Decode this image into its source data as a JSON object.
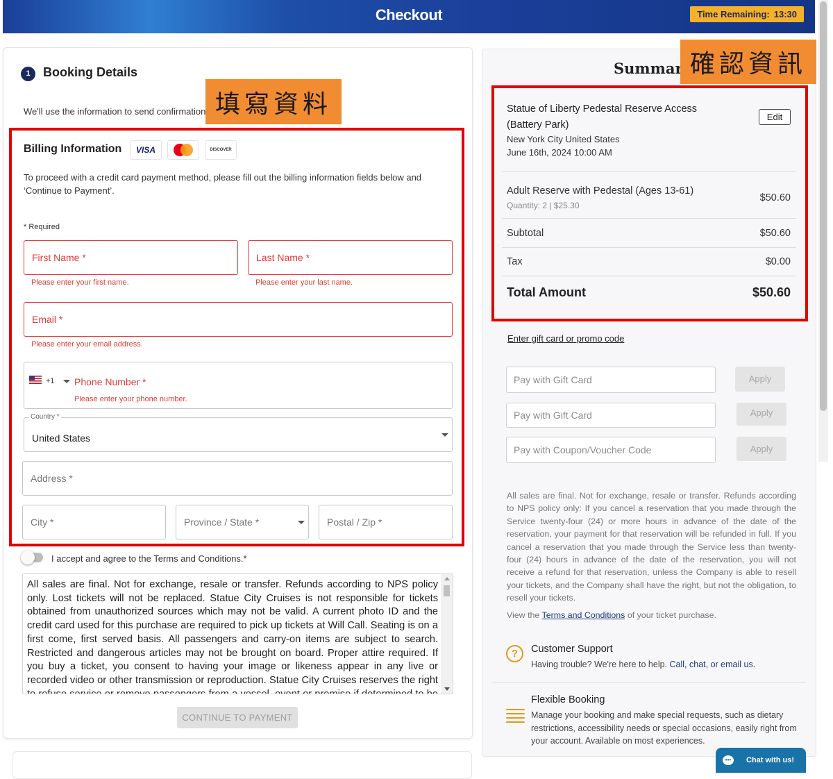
{
  "header": {
    "title": "Checkout",
    "timer_label": "Time Remaining:",
    "timer_value": "13:30"
  },
  "booking": {
    "step_number": "1",
    "title": "Booking Details",
    "confirmation_text": "We'll use the information to send confirmation"
  },
  "annotations": {
    "left": "填寫資料",
    "right": "確認資訊"
  },
  "billing": {
    "title": "Billing Information",
    "card_icons": [
      "VISA",
      "mastercard",
      "DISCOVER"
    ],
    "instructions": "To proceed with a credit card payment method, please fill out the billing information fields below and ‘Continue to Payment’.",
    "required_note": "* Required",
    "first_name": {
      "placeholder": "First Name *",
      "error": "Please enter your first name."
    },
    "last_name": {
      "placeholder": "Last Name *",
      "error": "Please enter your last name."
    },
    "email": {
      "placeholder": "Email *",
      "error": "Please enter your email address."
    },
    "phone": {
      "country_code": "+1",
      "placeholder": "Phone Number *",
      "error": "Please enter your phone number."
    },
    "country": {
      "label": "Country *",
      "value": "United States"
    },
    "address": {
      "placeholder": "Address *"
    },
    "city": {
      "placeholder": "City *"
    },
    "province": {
      "placeholder": "Province / State *"
    },
    "postal": {
      "placeholder": "Postal / Zip *"
    }
  },
  "terms": {
    "agree_label": "I accept and agree to the Terms and Conditions.*",
    "agree_checked": false,
    "text": "All sales are final. Not for exchange, resale or transfer. Refunds according to NPS policy only. Lost tickets will not be replaced. Statue City Cruises is not responsible for tickets obtained from unauthorized sources which may not be valid. A current photo ID and the credit card used for this purchase are required to pick up tickets at Will Call. Seating is on a first come, first served basis. All passengers and carry-on items are subject to search. Restricted and dangerous articles may not be brought on board. Proper attire required. If you buy a ticket, you consent to having your image or likeness appear in any live or recorded video or other transmission or reproduction. Statue City Cruises reserves the right to refuse service or remove passengers from a vessel, event or premise if determined to be necessary for"
  },
  "continue_button": "CONTINUE TO PAYMENT",
  "summary": {
    "title": "Summary",
    "item_title": "Statue of Liberty Pedestal Reserve Access (Battery Park)",
    "location": "New York City United States",
    "datetime": "June 16th, 2024 10:00 AM",
    "edit_label": "Edit",
    "line_item": {
      "name": "Adult Reserve with Pedestal (Ages 13-61)",
      "detail": "Quantity: 2 | $25.30",
      "price": "$50.60"
    },
    "subtotal_label": "Subtotal",
    "subtotal_value": "$50.60",
    "tax_label": "Tax",
    "tax_value": "$0.00",
    "total_label": "Total Amount",
    "total_value": "$50.60"
  },
  "promo": {
    "link": "Enter gift card or promo code",
    "gift1_placeholder": "Pay with Gift Card",
    "gift2_placeholder": "Pay with Gift Card",
    "coupon_placeholder": "Pay with Coupon/Voucher Code",
    "apply_label": "Apply"
  },
  "policy": {
    "text": "All sales are final. Not for exchange, resale or transfer. Refunds according to NPS policy only: If you cancel a reservation that you made through the Service twenty-four (24) or more hours in advance of the date of the reservation, your payment for that reservation will be refunded in full. If you cancel a reservation that you made through the Service less than twenty-four (24) hours in advance of the date of the reservation, you will not receive a refund for that reservation, unless the Company is able to resell your tickets, and the Company shall have the right, but not the obligation, to resell your tickets.",
    "view_prefix": "View the",
    "view_link": "Terms and Conditions",
    "view_suffix": "of your ticket purchase."
  },
  "support": {
    "title": "Customer Support",
    "desc_prefix": "Having trouble? We're here to help.",
    "desc_links": "Call, chat, or email us."
  },
  "flexible": {
    "title": "Flexible Booking",
    "desc": "Manage your booking and make special requests, such as dietary restrictions, accessibility needs or special occasions, easily right from your account. Available on most experiences."
  },
  "chat": {
    "label": "Chat with us!"
  },
  "colors": {
    "header_blue": "#1b3e98",
    "timer_yellow": "#f5b12a",
    "error_red": "#e53935",
    "annotation_orange": "#f28c33",
    "highlight_red": "#e20000",
    "accent_gold": "#e09a1a"
  }
}
